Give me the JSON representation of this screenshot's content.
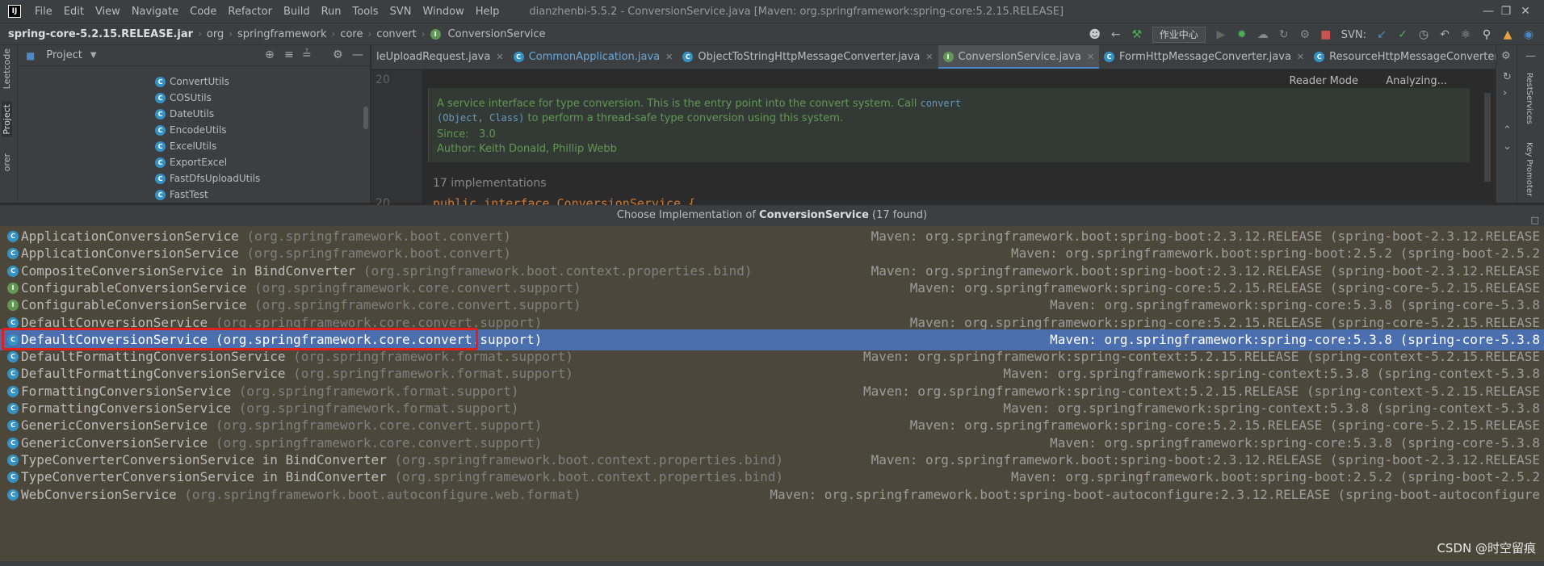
{
  "menubar": {
    "logo": "IJ",
    "items": [
      "File",
      "Edit",
      "View",
      "Navigate",
      "Code",
      "Refactor",
      "Build",
      "Run",
      "Tools",
      "SVN",
      "Window",
      "Help"
    ],
    "window_title": "dianzhenbi-5.5.2 - ConversionService.java [Maven: org.springframework:spring-core:5.2.15.RELEASE]"
  },
  "navbar": {
    "crumbs": [
      "spring-core-5.2.15.RELEASE.jar",
      "org",
      "springframework",
      "core",
      "convert",
      "ConversionService"
    ],
    "workcenter": "作业中心",
    "svn_label": "SVN:"
  },
  "left_strip": {
    "tabs": [
      "Leetcode",
      "Project",
      "orer"
    ]
  },
  "project": {
    "title": "Project",
    "items": [
      "ConvertUtils",
      "COSUtils",
      "DateUtils",
      "EncodeUtils",
      "ExcelUtils",
      "ExportExcel",
      "FastDfsUploadUtils",
      "FastTest"
    ]
  },
  "tabs": [
    {
      "label": "leUploadRequest.java",
      "icon": "class-icon"
    },
    {
      "label": "CommonApplication.java",
      "icon": "class-icon"
    },
    {
      "label": "ObjectToStringHttpMessageConverter.java",
      "icon": "class-icon"
    },
    {
      "label": "ConversionService.java",
      "icon": "interface-icon"
    },
    {
      "label": "FormHttpMessageConverter.java",
      "icon": "class-icon"
    },
    {
      "label": "ResourceHttpMessageConverter.java",
      "icon": "class-icon"
    }
  ],
  "right_strip": {
    "tabs": [
      "RestServices",
      "Key Promoter"
    ]
  },
  "editor": {
    "line_top": "20",
    "line_bottom": "20",
    "reader_mode": "Reader Mode",
    "analyzing": "Analyzing...",
    "doc_line1_text": "A service interface for type conversion. This is the entry point into the convert system. Call ",
    "doc_line1_code": "convert",
    "doc_line2_code": "(Object, Class)",
    "doc_line2_text": " to perform a thread-safe type conversion using this system.",
    "since_label": "Since:",
    "since_value": "3.0",
    "author_label": "Author:",
    "author_value": "Keith Donald, Phillip Webb",
    "implementations": "17 implementations",
    "code_line": "public interface ConversionService {"
  },
  "popup": {
    "header_prefix": "Choose Implementation of ",
    "header_bold": "ConversionService",
    "header_suffix": " (17 found)",
    "rows": [
      {
        "name": "ApplicationConversionService",
        "pkg": "(org.springframework.boot.convert)",
        "maven": "Maven: org.springframework.boot:spring-boot:2.3.12.RELEASE (spring-boot-2.3.12.RELEASE",
        "icon": "class"
      },
      {
        "name": "ApplicationConversionService",
        "pkg": "(org.springframework.boot.convert)",
        "maven": "Maven: org.springframework.boot:spring-boot:2.5.2 (spring-boot-2.5.2",
        "icon": "class"
      },
      {
        "name": "CompositeConversionService in BindConverter",
        "pkg": "(org.springframework.boot.context.properties.bind)",
        "maven": "Maven: org.springframework.boot:spring-boot:2.3.12.RELEASE (spring-boot-2.3.12.RELEASE",
        "icon": "class"
      },
      {
        "name": "ConfigurableConversionService",
        "pkg": "(org.springframework.core.convert.support)",
        "maven": "Maven: org.springframework:spring-core:5.2.15.RELEASE (spring-core-5.2.15.RELEASE",
        "icon": "interface"
      },
      {
        "name": "ConfigurableConversionService",
        "pkg": "(org.springframework.core.convert.support)",
        "maven": "Maven: org.springframework:spring-core:5.3.8 (spring-core-5.3.8",
        "icon": "interface"
      },
      {
        "name": "DefaultConversionService",
        "pkg": "(org.springframework.core.convert.support)",
        "maven": "Maven: org.springframework:spring-core:5.2.15.RELEASE (spring-core-5.2.15.RELEASE",
        "icon": "class"
      },
      {
        "name": "DefaultConversionService",
        "pkg": "(org.springframework.core.convert.support)",
        "maven": "Maven: org.springframework:spring-core:5.3.8 (spring-core-5.3.8",
        "icon": "class",
        "selected": true
      },
      {
        "name": "DefaultFormattingConversionService",
        "pkg": "(org.springframework.format.support)",
        "maven": "Maven: org.springframework:spring-context:5.2.15.RELEASE (spring-context-5.2.15.RELEASE",
        "icon": "class"
      },
      {
        "name": "DefaultFormattingConversionService",
        "pkg": "(org.springframework.format.support)",
        "maven": "Maven: org.springframework:spring-context:5.3.8 (spring-context-5.3.8",
        "icon": "class"
      },
      {
        "name": "FormattingConversionService",
        "pkg": "(org.springframework.format.support)",
        "maven": "Maven: org.springframework:spring-context:5.2.15.RELEASE (spring-context-5.2.15.RELEASE",
        "icon": "class"
      },
      {
        "name": "FormattingConversionService",
        "pkg": "(org.springframework.format.support)",
        "maven": "Maven: org.springframework:spring-context:5.3.8 (spring-context-5.3.8",
        "icon": "class"
      },
      {
        "name": "GenericConversionService",
        "pkg": "(org.springframework.core.convert.support)",
        "maven": "Maven: org.springframework:spring-core:5.2.15.RELEASE (spring-core-5.2.15.RELEASE",
        "icon": "class"
      },
      {
        "name": "GenericConversionService",
        "pkg": "(org.springframework.core.convert.support)",
        "maven": "Maven: org.springframework:spring-core:5.3.8 (spring-core-5.3.8",
        "icon": "class"
      },
      {
        "name": "TypeConverterConversionService in BindConverter",
        "pkg": "(org.springframework.boot.context.properties.bind)",
        "maven": "Maven: org.springframework.boot:spring-boot:2.3.12.RELEASE (spring-boot-2.3.12.RELEASE",
        "icon": "class"
      },
      {
        "name": "TypeConverterConversionService in BindConverter",
        "pkg": "(org.springframework.boot.context.properties.bind)",
        "maven": "Maven: org.springframework.boot:spring-boot:2.5.2 (spring-boot-2.5.2",
        "icon": "class"
      },
      {
        "name": "WebConversionService",
        "pkg": "(org.springframework.boot.autoconfigure.web.format)",
        "maven": "Maven: org.springframework.boot:spring-boot-autoconfigure:2.3.12.RELEASE (spring-boot-autoconfigure",
        "icon": "class"
      }
    ]
  },
  "watermark": "CSDN @时空留痕",
  "colors": {
    "selection": "#4b6eaf",
    "popup_bg": "#4b473a",
    "highlight_box": "#e0201a",
    "class_icon": "#3592c4",
    "interface_icon": "#629755"
  }
}
